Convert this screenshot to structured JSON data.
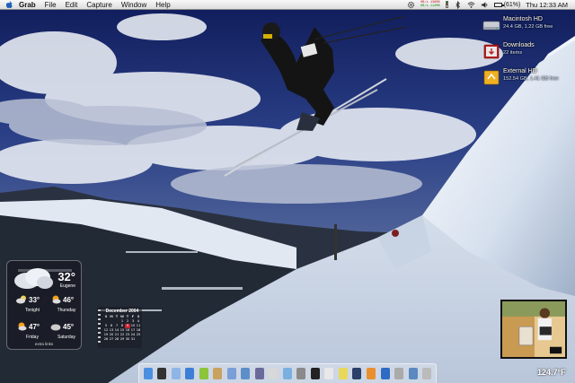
{
  "menubar": {
    "app": "Grab",
    "items": [
      "File",
      "Edit",
      "Capture",
      "Window",
      "Help"
    ],
    "netstat": {
      "in_label": "0B/s",
      "in_value": "436MB",
      "out_label": "0B/s",
      "out_value": "112MB"
    },
    "battery": "(61%)",
    "clock": "Thu 12:33 AM"
  },
  "volumes": [
    {
      "name": "Macintosh HD",
      "detail": "24.4 GB, 1.22 GB free",
      "icon": "hard-drive-icon"
    },
    {
      "name": "Downloads",
      "detail": "22 items",
      "icon": "downloads-folder-icon"
    },
    {
      "name": "External HD",
      "detail": "152.54 GB, 1.41 GB free",
      "icon": "external-drive-icon"
    }
  ],
  "weather": {
    "current_temp": "32°",
    "city": "Eugene",
    "days": [
      {
        "name": "Tonight",
        "temp": "33°",
        "icon": "cloud-moon-icon"
      },
      {
        "name": "Thursday",
        "temp": "46°",
        "icon": "sun-cloud-icon"
      },
      {
        "name": "Friday",
        "temp": "47°",
        "icon": "sun-cloud-icon"
      },
      {
        "name": "Saturday",
        "temp": "45°",
        "icon": "cloud-icon"
      }
    ],
    "extra": "extra links"
  },
  "calendar": {
    "title": "December 2004",
    "headers": [
      "S",
      "M",
      "T",
      "W",
      "T",
      "F",
      "S"
    ],
    "days": [
      "",
      "",
      "",
      "1",
      "2",
      "3",
      "4",
      "5",
      "6",
      "7",
      "8",
      "9",
      "10",
      "11",
      "12",
      "13",
      "14",
      "15",
      "16",
      "17",
      "18",
      "19",
      "20",
      "21",
      "22",
      "23",
      "24",
      "25",
      "26",
      "27",
      "28",
      "29",
      "30",
      "31",
      ""
    ],
    "today": "9"
  },
  "dock": {
    "icons": [
      "finder",
      "dashboard",
      "mail",
      "safari",
      "ichat",
      "address-book",
      "itunes",
      "iphoto",
      "imovie",
      "ical",
      "preview",
      "system-preferences",
      "terminal",
      "textedit",
      "stickies",
      "photoshop",
      "illustrator",
      "firefox",
      "calculator",
      "network",
      "trash"
    ],
    "colors": [
      "#4b8fe0",
      "#333",
      "#8fb5e8",
      "#3d7fd6",
      "#8cc43a",
      "#c9a25f",
      "#7a9ed8",
      "#5c8fc8",
      "#6a6a9a",
      "#d8d8d8",
      "#7ab0e0",
      "#8a8a8a",
      "#222",
      "#e8e8e8",
      "#e8d85a",
      "#2c3f6a",
      "#e89030",
      "#2e6bc4",
      "#aaa",
      "#5a8ac0",
      "#bbb"
    ]
  },
  "temperature_readout": "124.7°F"
}
